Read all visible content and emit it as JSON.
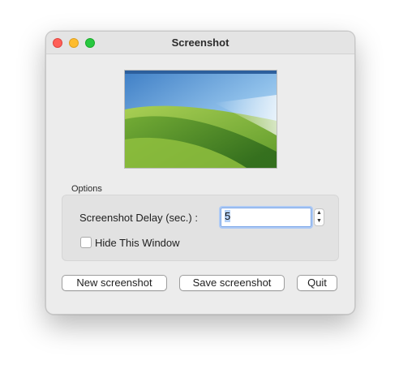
{
  "window": {
    "title": "Screenshot"
  },
  "options": {
    "label": "Options",
    "delay_label": "Screenshot Delay (sec.) :",
    "delay_value": "5",
    "hide_window_label": "Hide This Window",
    "hide_window_checked": false
  },
  "buttons": {
    "new_screenshot": "New screenshot",
    "save_screenshot": "Save screenshot",
    "quit": "Quit"
  },
  "icons": {
    "close": "close-icon",
    "minimize": "minimize-icon",
    "maximize": "maximize-icon",
    "stepper_up": "chevron-up-icon",
    "stepper_down": "chevron-down-icon"
  },
  "colors": {
    "close": "#ff5f57",
    "minimize": "#febc2e",
    "maximize": "#28c840",
    "focus_ring": "#7da7e8"
  }
}
